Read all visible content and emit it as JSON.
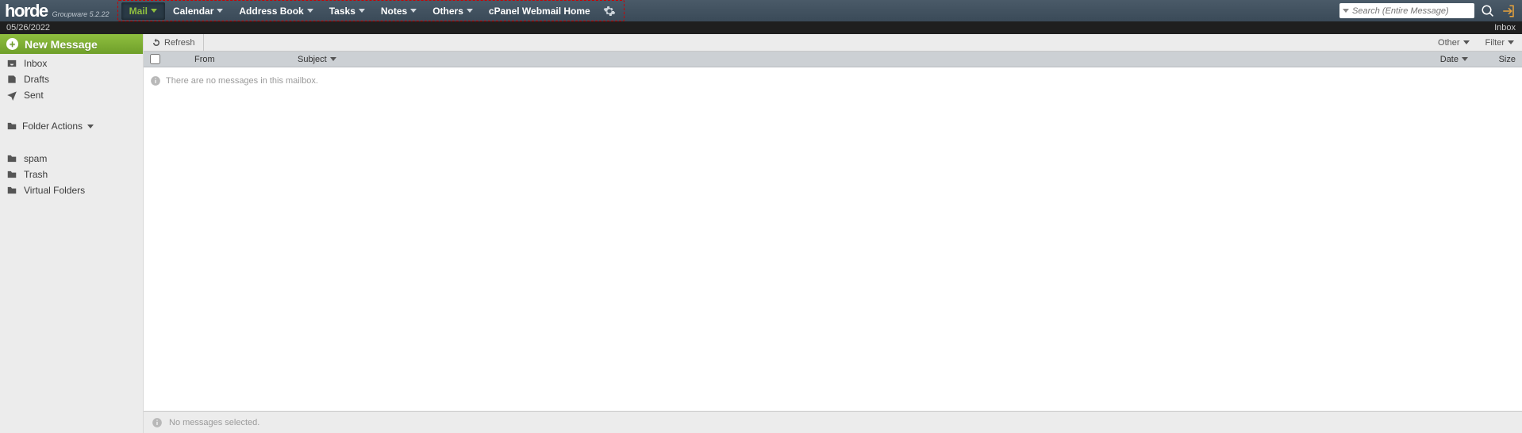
{
  "brand": {
    "name": "horde",
    "tagline": "Groupware 5.2.22"
  },
  "topnav": {
    "items": [
      {
        "label": "Mail",
        "active": true,
        "dropdown": true
      },
      {
        "label": "Calendar",
        "dropdown": true
      },
      {
        "label": "Address Book",
        "dropdown": true
      },
      {
        "label": "Tasks",
        "dropdown": true
      },
      {
        "label": "Notes",
        "dropdown": true
      },
      {
        "label": "Others",
        "dropdown": true
      },
      {
        "label": "cPanel Webmail Home",
        "dropdown": false
      }
    ]
  },
  "search": {
    "placeholder": "Search (Entire Message)"
  },
  "subbar": {
    "date": "05/26/2022",
    "crumb": "Inbox"
  },
  "sidebar": {
    "new_message": "New Message",
    "mailboxes": [
      {
        "label": "Inbox",
        "icon": "inbox"
      },
      {
        "label": "Drafts",
        "icon": "draft"
      },
      {
        "label": "Sent",
        "icon": "sent"
      }
    ],
    "folder_actions": "Folder Actions",
    "extra": [
      {
        "label": "spam",
        "icon": "folder"
      },
      {
        "label": "Trash",
        "icon": "folder"
      },
      {
        "label": "Virtual Folders",
        "icon": "vfolder"
      }
    ]
  },
  "toolbar": {
    "refresh": "Refresh",
    "other": "Other",
    "filter": "Filter"
  },
  "table": {
    "headers": {
      "from": "From",
      "subject": "Subject",
      "date": "Date",
      "size": "Size"
    },
    "empty": "There are no messages in this mailbox."
  },
  "status": {
    "none_selected": "No messages selected."
  }
}
